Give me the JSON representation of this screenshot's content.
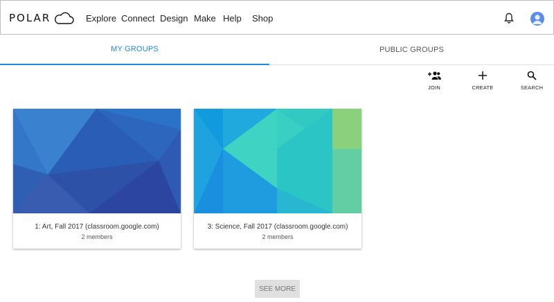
{
  "header": {
    "logo_text": "POLAR",
    "nav": [
      "Explore",
      "Connect",
      "Design",
      "Make",
      "Help",
      "Shop"
    ],
    "icons": {
      "notifications": "bell-icon",
      "account": "avatar-icon"
    }
  },
  "tabs": [
    {
      "label": "MY GROUPS",
      "active": true
    },
    {
      "label": "PUBLIC GROUPS",
      "active": false
    }
  ],
  "actions": [
    {
      "label": "JOIN",
      "icon": "group-add-icon"
    },
    {
      "label": "CREATE",
      "icon": "plus-icon"
    },
    {
      "label": "SEARCH",
      "icon": "search-icon"
    }
  ],
  "groups": [
    {
      "title": "1: Art, Fall 2017 (classroom.google.com)",
      "members": "2 members"
    },
    {
      "title": "3: Science, Fall 2017 (classroom.google.com)",
      "members": "2 members"
    }
  ],
  "see_more_label": "SEE MORE",
  "colors": {
    "accent": "#1e88e5",
    "avatar": "#5b8de8"
  }
}
